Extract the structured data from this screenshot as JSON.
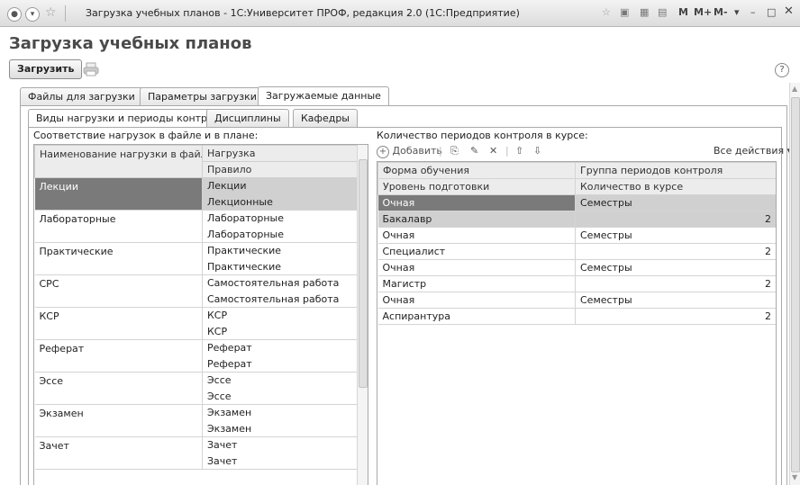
{
  "window": {
    "title": "Загрузка учебных планов - 1С:Университет ПРОФ, редакция 2.0  (1С:Предприятие)",
    "controls": [
      "M",
      "M+",
      "M-"
    ]
  },
  "form": {
    "title": "Загрузка учебных планов",
    "load_button": "Загрузить"
  },
  "tabs": [
    "Файлы для загрузки",
    "Параметры загрузки",
    "Загружаемые данные"
  ],
  "subtabs": [
    "Виды нагрузки и периоды контроля",
    "Дисциплины",
    "Кафедры"
  ],
  "left": {
    "caption": "Соответствие нагрузок в файле и в плане:",
    "headers": {
      "col1": "Наименование нагрузки в файле",
      "col2": "Нагрузка",
      "col2b": "Правило"
    },
    "rows": [
      {
        "name": "Лекции",
        "load": "Лекции",
        "rule": "Лекционные"
      },
      {
        "name": "Лабораторные",
        "load": "Лабораторные",
        "rule": "Лабораторные"
      },
      {
        "name": "Практические",
        "load": "Практические",
        "rule": "Практические"
      },
      {
        "name": "СРС",
        "load": "Самостоятельная работа",
        "rule": "Самостоятельная работа"
      },
      {
        "name": "КСР",
        "load": "КСР",
        "rule": "КСР"
      },
      {
        "name": "Реферат",
        "load": "Реферат",
        "rule": "Реферат"
      },
      {
        "name": "Эссе",
        "load": "Эссе",
        "rule": "Эссе"
      },
      {
        "name": "Экзамен",
        "load": "Экзамен",
        "rule": "Экзамен"
      },
      {
        "name": "Зачет",
        "load": "Зачет",
        "rule": "Зачет"
      }
    ]
  },
  "right": {
    "caption": "Количество периодов контроля в курсе:",
    "add_label": "Добавить",
    "all_actions": "Все действия",
    "headers": {
      "c1a": "Форма обучения",
      "c2a": "Группа периодов контроля",
      "c1b": "Уровень подготовки",
      "c2b": "Количество в курсе"
    },
    "rows": [
      {
        "form": "Очная",
        "group": "Семестры",
        "level": "Бакалавр",
        "count": "2"
      },
      {
        "form": "Очная",
        "group": "Семестры",
        "level": "Специалист",
        "count": "2"
      },
      {
        "form": "Очная",
        "group": "Семестры",
        "level": "Магистр",
        "count": "2"
      },
      {
        "form": "Очная",
        "group": "Семестры",
        "level": "Аспирантура",
        "count": "2"
      }
    ]
  }
}
